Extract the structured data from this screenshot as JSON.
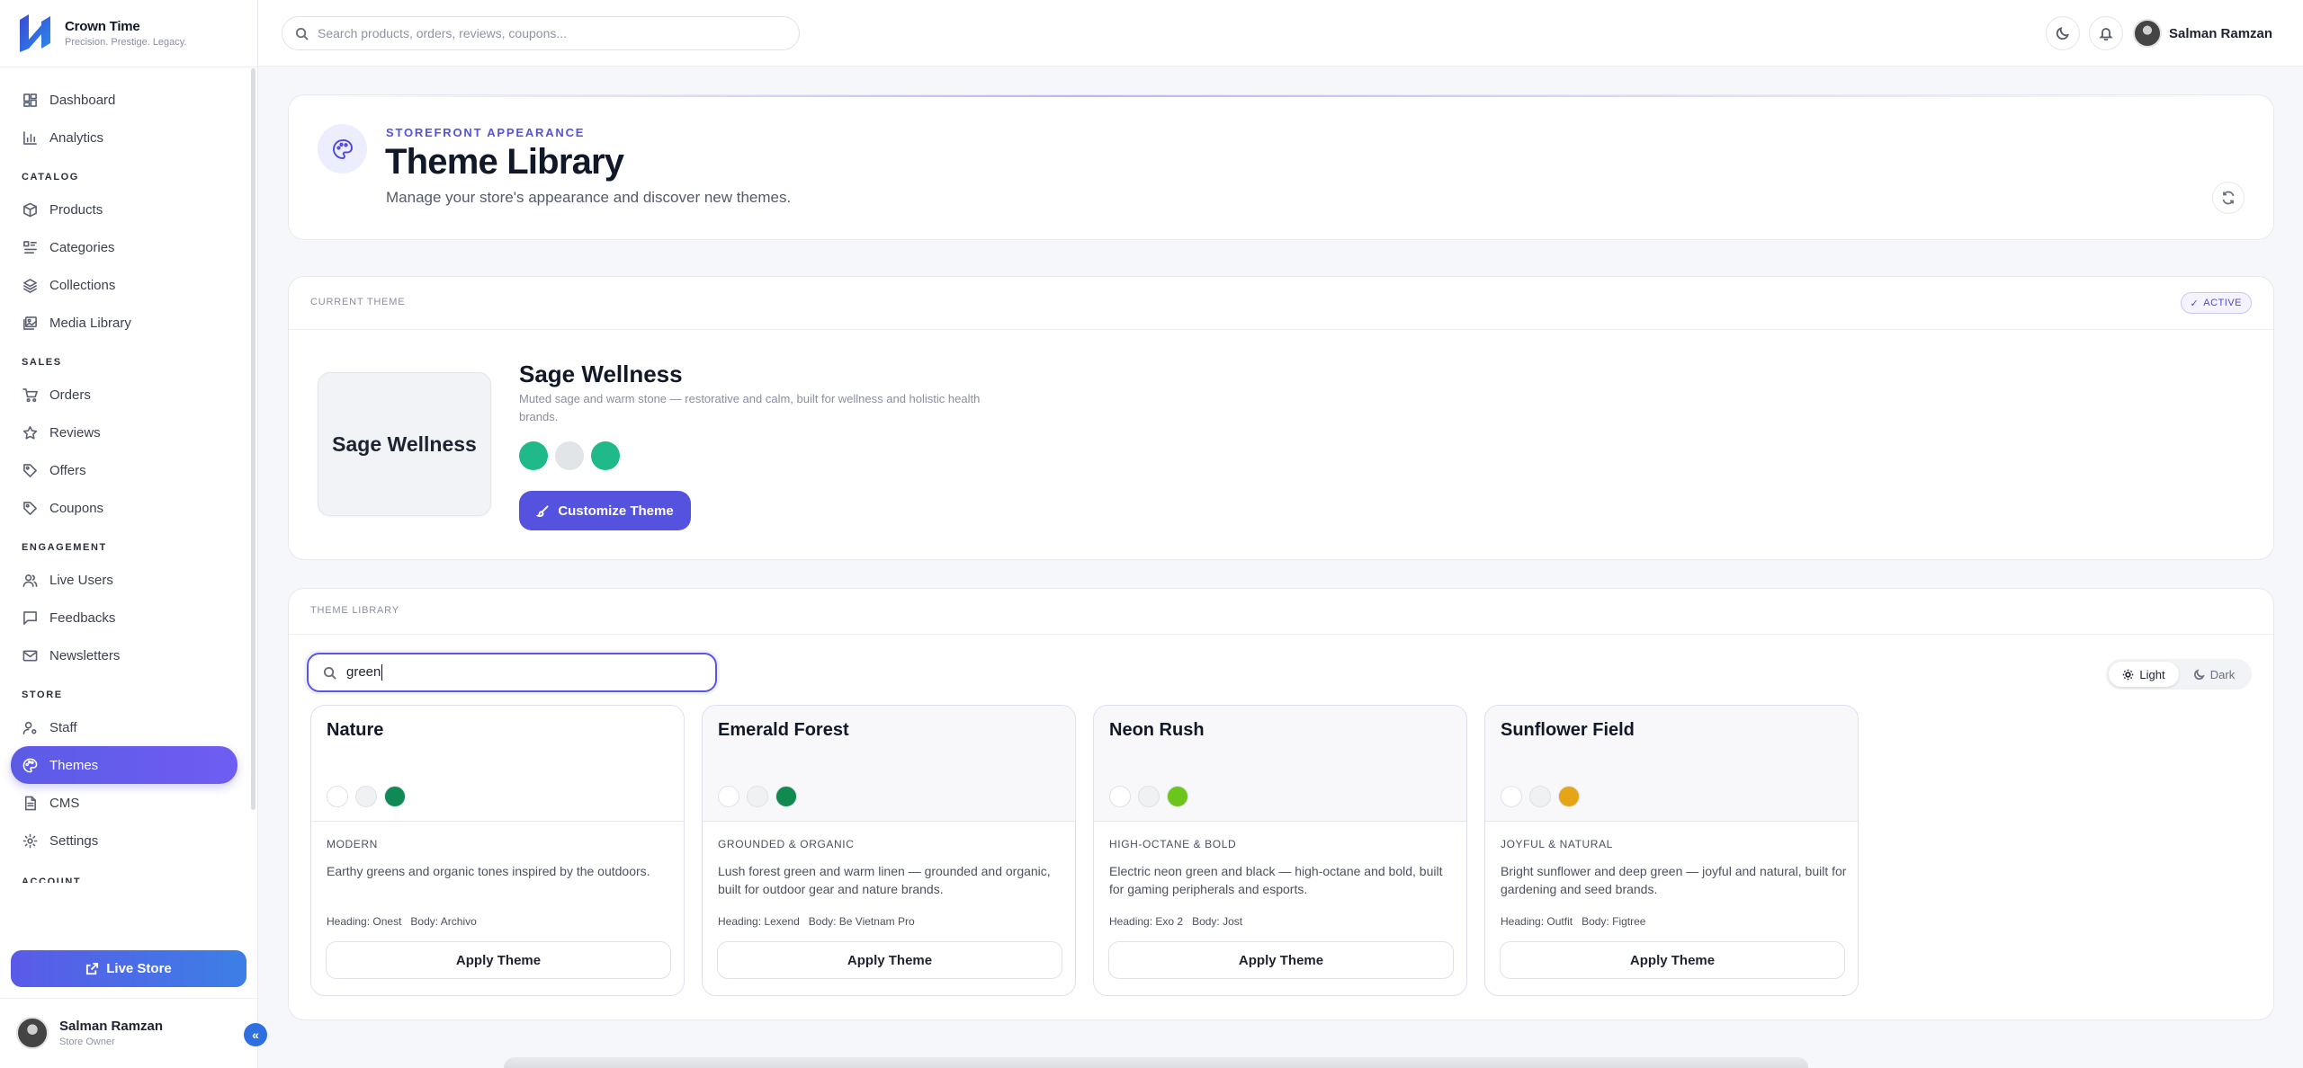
{
  "brand": {
    "name": "Crown Time",
    "tagline": "Precision. Prestige. Legacy."
  },
  "sidebar": {
    "top_items": [
      {
        "label": "Dashboard",
        "icon": "dashboard-icon"
      },
      {
        "label": "Analytics",
        "icon": "analytics-icon"
      }
    ],
    "sections": [
      {
        "title": "CATALOG",
        "items": [
          {
            "label": "Products"
          },
          {
            "label": "Categories"
          },
          {
            "label": "Collections"
          },
          {
            "label": "Media Library"
          }
        ]
      },
      {
        "title": "SALES",
        "items": [
          {
            "label": "Orders"
          },
          {
            "label": "Reviews"
          },
          {
            "label": "Offers"
          },
          {
            "label": "Coupons"
          }
        ]
      },
      {
        "title": "ENGAGEMENT",
        "items": [
          {
            "label": "Live Users"
          },
          {
            "label": "Feedbacks"
          },
          {
            "label": "Newsletters"
          }
        ]
      },
      {
        "title": "STORE",
        "items": [
          {
            "label": "Staff"
          },
          {
            "label": "Themes",
            "active": true
          },
          {
            "label": "CMS"
          },
          {
            "label": "Settings"
          }
        ]
      },
      {
        "title": "ACCOUNT",
        "items": []
      }
    ],
    "live_store_label": "Live Store",
    "user": {
      "name": "Salman Ramzan",
      "role": "Store Owner"
    }
  },
  "header": {
    "search_placeholder": "Search products, orders, reviews, coupons...",
    "user_name": "Salman Ramzan"
  },
  "hero": {
    "kicker": "STOREFRONT APPEARANCE",
    "title": "Theme Library",
    "subtitle": "Manage your store's appearance and discover new themes."
  },
  "current_theme": {
    "section_label": "CURRENT THEME",
    "badge": "ACTIVE",
    "preview_text": "Sage Wellness",
    "name": "Sage Wellness",
    "description": "Muted sage and warm stone — restorative and calm, built for wellness and holistic health brands.",
    "swatches": [
      "#1fb98a",
      "#e2e5e8",
      "#1fb98a"
    ],
    "customize_label": "Customize Theme"
  },
  "library": {
    "section_label": "THEME LIBRARY",
    "search_value": "green",
    "toggle": {
      "light": "Light",
      "dark": "Dark",
      "selected": "Light"
    },
    "heading_label": "Heading:",
    "body_label": "Body:",
    "apply_label": "Apply Theme",
    "themes": [
      {
        "name": "Nature",
        "category": "MODERN",
        "description": "Earthy greens and organic tones inspired by the outdoors.",
        "heading_font": "Onest",
        "body_font": "Archivo",
        "swatches": [
          "#ffffff",
          "#f0f1f3",
          "#0f8a55"
        ]
      },
      {
        "name": "Emerald Forest",
        "category": "GROUNDED & ORGANIC",
        "description": "Lush forest green and warm linen — grounded and organic, built for outdoor gear and nature brands.",
        "heading_font": "Lexend",
        "body_font": "Be Vietnam Pro",
        "swatches": [
          "#ffffff",
          "#f0f1f3",
          "#108a4e"
        ]
      },
      {
        "name": "Neon Rush",
        "category": "HIGH-OCTANE & BOLD",
        "description": "Electric neon green and black — high-octane and bold, built for gaming peripherals and esports.",
        "heading_font": "Exo 2",
        "body_font": "Jost",
        "swatches": [
          "#ffffff",
          "#f0f1f3",
          "#6cc51a"
        ]
      },
      {
        "name": "Sunflower Field",
        "category": "JOYFUL & NATURAL",
        "description": "Bright sunflower and deep green — joyful and natural, built for gardening and seed brands.",
        "heading_font": "Outfit",
        "body_font": "Figtree",
        "swatches": [
          "#ffffff",
          "#f0f1f3",
          "#e6a514"
        ]
      }
    ]
  },
  "colors": {
    "accent": "#5552e0",
    "active_nav": "#5b5be6",
    "live_store": "#3c7fe6"
  }
}
